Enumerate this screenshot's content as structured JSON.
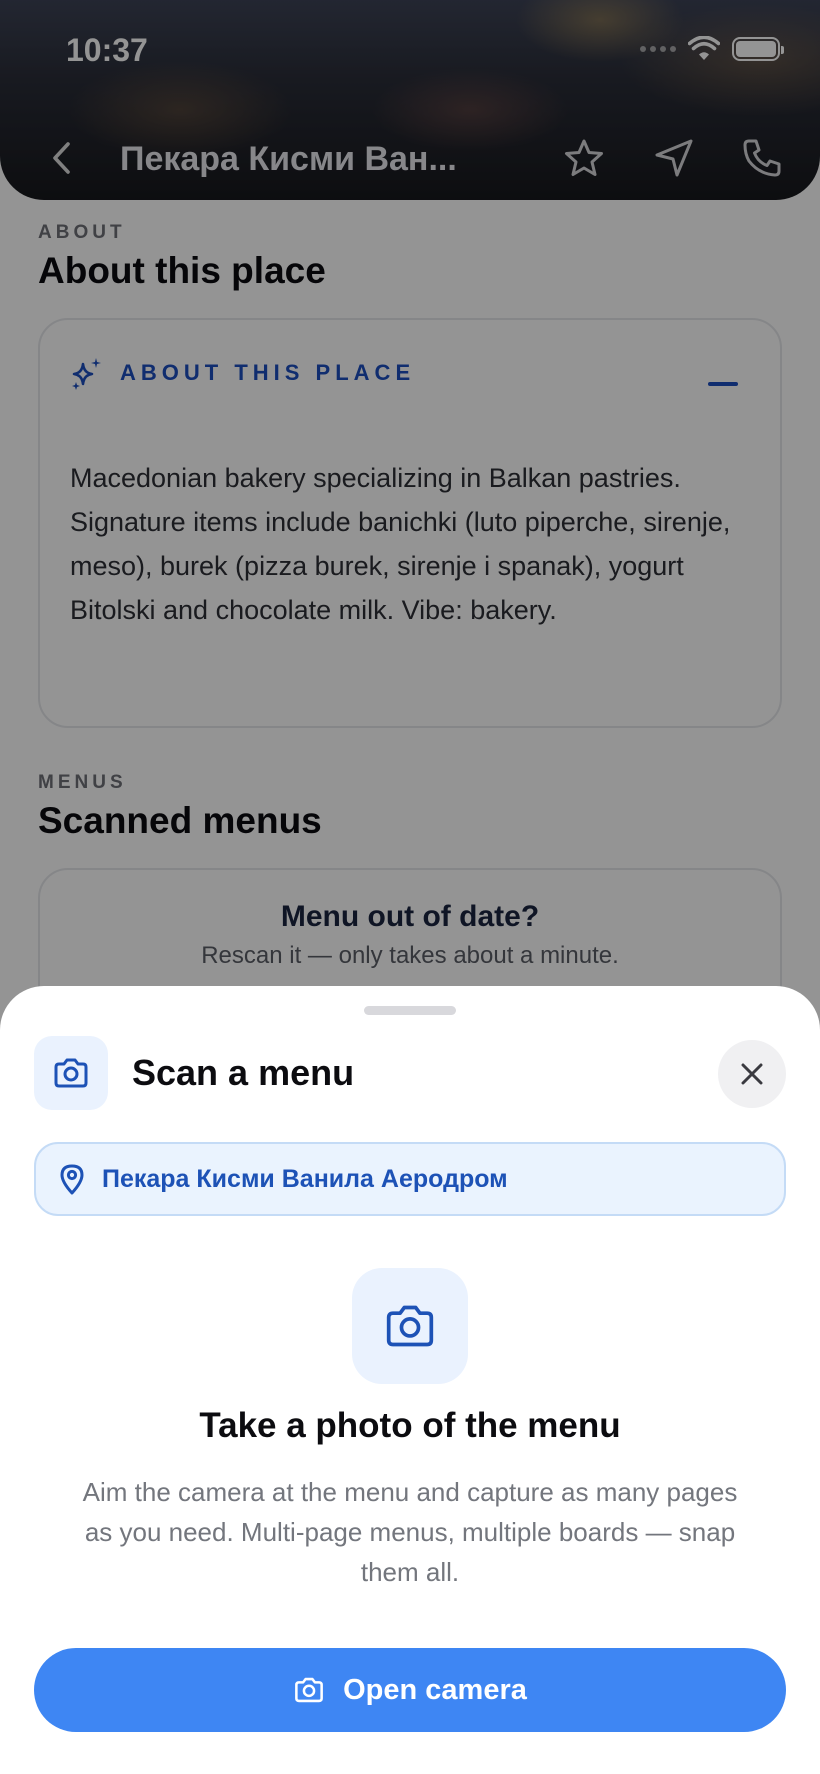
{
  "status_bar": {
    "time": "10:37"
  },
  "nav": {
    "title": "Пекара Кисми Ван...",
    "back_icon": "chevron-left-icon",
    "favorite_icon": "star-icon",
    "directions_icon": "navigation-arrow-icon",
    "call_icon": "phone-icon"
  },
  "about": {
    "eyebrow": "ABOUT",
    "title": "About this place",
    "card_label": "ABOUT THIS PLACE",
    "card_icon": "sparkles-icon",
    "description": "Macedonian bakery specializing in Balkan pastries. Signature items include banichki (luto piperche, sirenje, meso), burek (pizza burek, sirenje i spanak), yogurt Bitolski and chocolate milk. Vibe: bakery."
  },
  "menus": {
    "eyebrow": "MENUS",
    "title": "Scanned menus",
    "card_title": "Menu out of date?",
    "card_subtitle": "Rescan it — only takes about a minute."
  },
  "sheet": {
    "title": "Scan a menu",
    "place_name": "Пекара Кисми Ванила Аеродром",
    "photo_title": "Take a photo of the menu",
    "photo_description": "Aim the camera at the menu and capture as many pages as you need. Multi-page menus, multiple boards — snap them all.",
    "open_camera_label": "Open camera"
  },
  "colors": {
    "accent_blue": "#3e86f3",
    "label_blue": "#1d4fbf",
    "pill_background": "#eaf3fe"
  }
}
